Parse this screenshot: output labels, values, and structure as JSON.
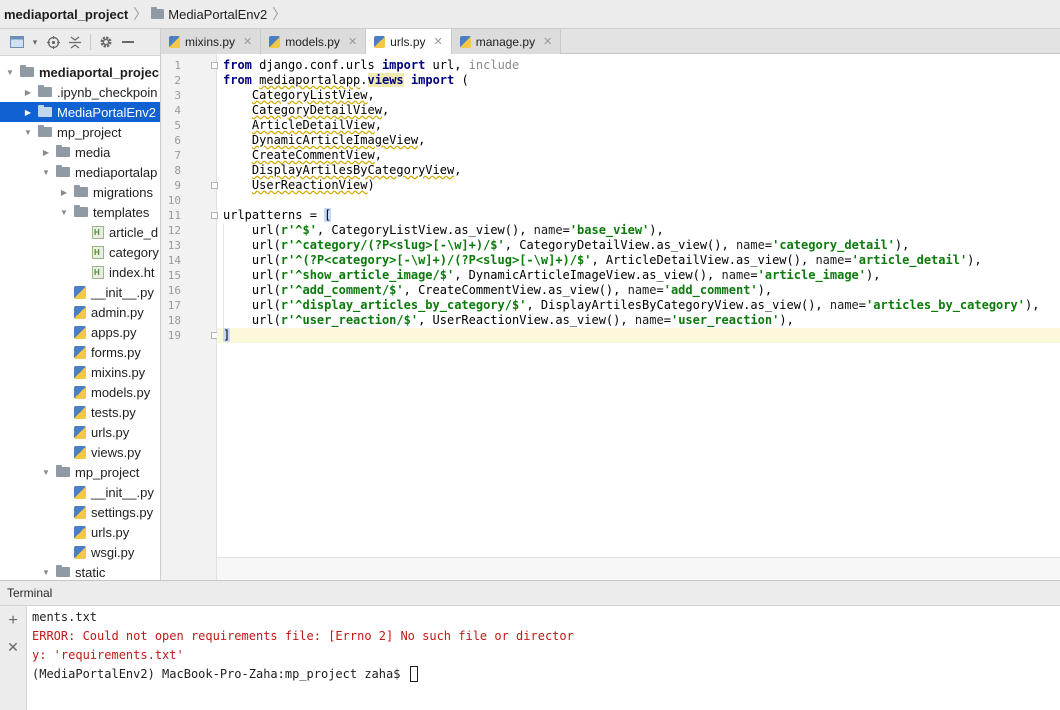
{
  "breadcrumb": {
    "project": "mediaportal_project",
    "folder": "MediaPortalEnv2"
  },
  "project_tree": {
    "root": "mediaportal_project",
    "items": [
      {
        "label": "mediaportal_projec",
        "kind": "folder",
        "depth": 0,
        "expanded": true,
        "bold": true
      },
      {
        "label": ".ipynb_checkpoin",
        "kind": "folder",
        "depth": 1,
        "expanded": false
      },
      {
        "label": "MediaPortalEnv2",
        "kind": "folder",
        "depth": 1,
        "expanded": false,
        "selected": true
      },
      {
        "label": "mp_project",
        "kind": "folder",
        "depth": 1,
        "expanded": true
      },
      {
        "label": "media",
        "kind": "folder",
        "depth": 2,
        "expanded": false
      },
      {
        "label": "mediaportalap",
        "kind": "folder",
        "depth": 2,
        "expanded": true
      },
      {
        "label": "migrations",
        "kind": "folder",
        "depth": 3,
        "expanded": false
      },
      {
        "label": "templates",
        "kind": "folder",
        "depth": 3,
        "expanded": true
      },
      {
        "label": "article_d",
        "kind": "html",
        "depth": 4
      },
      {
        "label": "category",
        "kind": "html",
        "depth": 4
      },
      {
        "label": "index.ht",
        "kind": "html",
        "depth": 4
      },
      {
        "label": "__init__.py",
        "kind": "py",
        "depth": 3
      },
      {
        "label": "admin.py",
        "kind": "py",
        "depth": 3
      },
      {
        "label": "apps.py",
        "kind": "py",
        "depth": 3
      },
      {
        "label": "forms.py",
        "kind": "py",
        "depth": 3
      },
      {
        "label": "mixins.py",
        "kind": "py",
        "depth": 3
      },
      {
        "label": "models.py",
        "kind": "py",
        "depth": 3
      },
      {
        "label": "tests.py",
        "kind": "py",
        "depth": 3
      },
      {
        "label": "urls.py",
        "kind": "py",
        "depth": 3
      },
      {
        "label": "views.py",
        "kind": "py",
        "depth": 3
      },
      {
        "label": "mp_project",
        "kind": "folder",
        "depth": 2,
        "expanded": true
      },
      {
        "label": "__init__.py",
        "kind": "py",
        "depth": 3
      },
      {
        "label": "settings.py",
        "kind": "py",
        "depth": 3
      },
      {
        "label": "urls.py",
        "kind": "py",
        "depth": 3
      },
      {
        "label": "wsgi.py",
        "kind": "py",
        "depth": 3
      },
      {
        "label": "static",
        "kind": "folder",
        "depth": 2,
        "expanded": true
      }
    ]
  },
  "tabs": [
    {
      "label": "mixins.py",
      "active": false
    },
    {
      "label": "models.py",
      "active": false
    },
    {
      "label": "urls.py",
      "active": true
    },
    {
      "label": "manage.py",
      "active": false
    }
  ],
  "editor": {
    "current_line": 19,
    "lines": [
      [
        {
          "t": "from",
          "c": "kw"
        },
        {
          "t": " django.conf.urls ",
          "c": ""
        },
        {
          "t": "import",
          "c": "kw"
        },
        {
          "t": " url, ",
          "c": ""
        },
        {
          "t": "include",
          "c": "grey"
        }
      ],
      [
        {
          "t": "from",
          "c": "kw"
        },
        {
          "t": " ",
          "c": ""
        },
        {
          "t": "mediaportalapp",
          "c": "squig"
        },
        {
          "t": ".",
          "c": ""
        },
        {
          "t": "views",
          "c": "meth"
        },
        {
          "t": " ",
          "c": ""
        },
        {
          "t": "import",
          "c": "kw"
        },
        {
          "t": " (",
          "c": ""
        }
      ],
      [
        {
          "t": "    ",
          "c": ""
        },
        {
          "t": "CategoryListView",
          "c": "squig"
        },
        {
          "t": ",",
          "c": ""
        }
      ],
      [
        {
          "t": "    ",
          "c": ""
        },
        {
          "t": "CategoryDetailView",
          "c": "squig"
        },
        {
          "t": ",",
          "c": ""
        }
      ],
      [
        {
          "t": "    ",
          "c": ""
        },
        {
          "t": "ArticleDetailView",
          "c": "squig"
        },
        {
          "t": ",",
          "c": ""
        }
      ],
      [
        {
          "t": "    ",
          "c": ""
        },
        {
          "t": "DynamicArticleImageView",
          "c": "squig"
        },
        {
          "t": ",",
          "c": ""
        }
      ],
      [
        {
          "t": "    ",
          "c": ""
        },
        {
          "t": "CreateCommentView",
          "c": "squig"
        },
        {
          "t": ",",
          "c": ""
        }
      ],
      [
        {
          "t": "    ",
          "c": ""
        },
        {
          "t": "DisplayArtilesByCategoryView",
          "c": "squig"
        },
        {
          "t": ",",
          "c": ""
        }
      ],
      [
        {
          "t": "    ",
          "c": ""
        },
        {
          "t": "UserReactionView",
          "c": "squig"
        },
        {
          "t": ")",
          "c": ""
        }
      ],
      [],
      [
        {
          "t": "urlpatterns = ",
          "c": ""
        },
        {
          "t": "[",
          "c": "bracket-hl"
        }
      ],
      [
        {
          "t": "    url(",
          "c": ""
        },
        {
          "t": "r'^$'",
          "c": "str"
        },
        {
          "t": ", CategoryListView.as_view(), ",
          "c": ""
        },
        {
          "t": "name",
          "c": "mod"
        },
        {
          "t": "=",
          "c": ""
        },
        {
          "t": "'base_view'",
          "c": "str"
        },
        {
          "t": "),",
          "c": ""
        }
      ],
      [
        {
          "t": "    url(",
          "c": ""
        },
        {
          "t": "r'^category/(?P<slug>[-\\w]+)/$'",
          "c": "str"
        },
        {
          "t": ", CategoryDetailView.as_view(), ",
          "c": ""
        },
        {
          "t": "name",
          "c": "mod"
        },
        {
          "t": "=",
          "c": ""
        },
        {
          "t": "'category_detail'",
          "c": "str"
        },
        {
          "t": "),",
          "c": ""
        }
      ],
      [
        {
          "t": "    url(",
          "c": ""
        },
        {
          "t": "r'^(?P<category>[-\\w]+)/(?P<slug>[-\\w]+)/$'",
          "c": "str"
        },
        {
          "t": ", ArticleDetailView.as_view(), ",
          "c": ""
        },
        {
          "t": "name",
          "c": "mod"
        },
        {
          "t": "=",
          "c": ""
        },
        {
          "t": "'article_detail'",
          "c": "str"
        },
        {
          "t": "),",
          "c": ""
        }
      ],
      [
        {
          "t": "    url(",
          "c": ""
        },
        {
          "t": "r'^show_article_image/$'",
          "c": "str"
        },
        {
          "t": ", DynamicArticleImageView.as_view(), ",
          "c": ""
        },
        {
          "t": "name",
          "c": "mod"
        },
        {
          "t": "=",
          "c": ""
        },
        {
          "t": "'article_image'",
          "c": "str"
        },
        {
          "t": "),",
          "c": ""
        }
      ],
      [
        {
          "t": "    url(",
          "c": ""
        },
        {
          "t": "r'^add_comment/$'",
          "c": "str"
        },
        {
          "t": ", CreateCommentView.as_view(), ",
          "c": ""
        },
        {
          "t": "name",
          "c": "mod"
        },
        {
          "t": "=",
          "c": ""
        },
        {
          "t": "'add_comment'",
          "c": "str"
        },
        {
          "t": "),",
          "c": ""
        }
      ],
      [
        {
          "t": "    url(",
          "c": ""
        },
        {
          "t": "r'^display_articles_by_category/$'",
          "c": "str"
        },
        {
          "t": ", DisplayArtilesByCategoryView.as_view(), ",
          "c": ""
        },
        {
          "t": "name",
          "c": "mod"
        },
        {
          "t": "=",
          "c": ""
        },
        {
          "t": "'articles_by_category'",
          "c": "str"
        },
        {
          "t": "),",
          "c": ""
        }
      ],
      [
        {
          "t": "    url(",
          "c": ""
        },
        {
          "t": "r'^user_reaction/$'",
          "c": "str"
        },
        {
          "t": ", UserReactionView.as_view(), ",
          "c": ""
        },
        {
          "t": "name",
          "c": "mod"
        },
        {
          "t": "=",
          "c": ""
        },
        {
          "t": "'user_reaction'",
          "c": "str"
        },
        {
          "t": "),",
          "c": ""
        }
      ],
      [
        {
          "t": "]",
          "c": "bracket-hl"
        }
      ]
    ]
  },
  "terminal": {
    "title": "Terminal",
    "lines": [
      {
        "text": "ments.txt",
        "error": false
      },
      {
        "text": "ERROR: Could not open requirements file: [Errno 2] No such file or director",
        "error": true
      },
      {
        "text": "y: 'requirements.txt'",
        "error": true
      },
      {
        "text": "(MediaPortalEnv2) MacBook-Pro-Zaha:mp_project zaha$ ",
        "error": false,
        "prompt": true
      }
    ]
  },
  "colors": {
    "selection": "#1061d1",
    "keyword": "#000080",
    "string": "#0b7a0b",
    "error": "#c31818",
    "current_line": "#fbf8dc"
  }
}
